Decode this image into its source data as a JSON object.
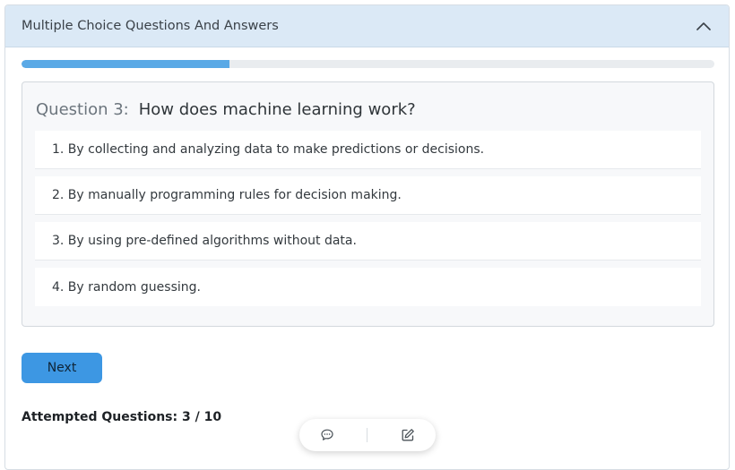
{
  "panel": {
    "title": "Multiple Choice Questions And Answers",
    "toggle_icon": "chevron-up-icon"
  },
  "progress": {
    "fraction": 0.3
  },
  "question": {
    "number_label": "Question 3:",
    "text": "How does machine learning work?",
    "options": [
      "1. By collecting and analyzing data to make predictions or decisions.",
      "2. By manually programming rules for decision making.",
      "3. By using pre-defined algorithms without data.",
      "4. By random guessing."
    ]
  },
  "actions": {
    "next_label": "Next"
  },
  "status": {
    "attempted": "Attempted Questions: 3 / 10"
  },
  "floating_toolbar": {
    "icons": [
      "chat-icon",
      "edit-icon"
    ]
  },
  "colors": {
    "header_bg": "#dbe9f6",
    "progress_fill": "#5aa9e6",
    "button_bg": "#3d97e3"
  }
}
